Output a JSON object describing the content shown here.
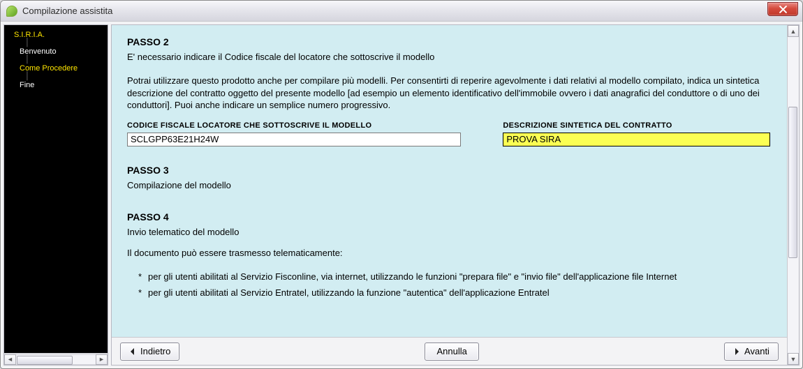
{
  "window": {
    "title": "Compilazione assistita"
  },
  "sidebar": {
    "items": [
      {
        "label": "S.I.R.I.A.",
        "root": true
      },
      {
        "label": "Benvenuto"
      },
      {
        "label": "Come Procedere",
        "selected": true
      },
      {
        "label": "Fine"
      }
    ]
  },
  "content": {
    "step2": {
      "heading": "PASSO 2",
      "intro": "E' necessario indicare il Codice fiscale del locatore che sottoscrive il modello",
      "para": "Potrai utilizzare questo prodotto anche per compilare più modelli. Per consentirti di reperire agevolmente i dati relativi al modello compilato, indica un sintetica descrizione del contratto oggetto del presente modello [ad esempio un elemento identificativo dell'immobile ovvero i dati anagrafici del conduttore o di uno dei conduttori]. Puoi anche indicare un semplice numero progressivo.",
      "field_cf": {
        "label": "CODICE FISCALE LOCATORE CHE SOTTOSCRIVE IL MODELLO",
        "value": "SCLGPP63E21H24W"
      },
      "field_desc": {
        "label": "DESCRIZIONE SINTETICA DEL CONTRATTO",
        "value": "PROVA SIRA"
      }
    },
    "step3": {
      "heading": "PASSO 3",
      "line": "Compilazione del modello"
    },
    "step4": {
      "heading": "PASSO 4",
      "line": "Invio telematico del modello",
      "para": "Il documento può essere trasmesso telematicamente:",
      "bullets": [
        "per gli utenti abilitati al Servizio Fisconline, via internet, utilizzando le funzioni \"prepara file\" e \"invio file\" dell'applicazione file Internet",
        "per gli utenti abilitati al Servizio Entratel, utilizzando la funzione \"autentica\" dell'applicazione Entratel"
      ]
    }
  },
  "footer": {
    "back": "Indietro",
    "cancel": "Annulla",
    "next": "Avanti"
  }
}
